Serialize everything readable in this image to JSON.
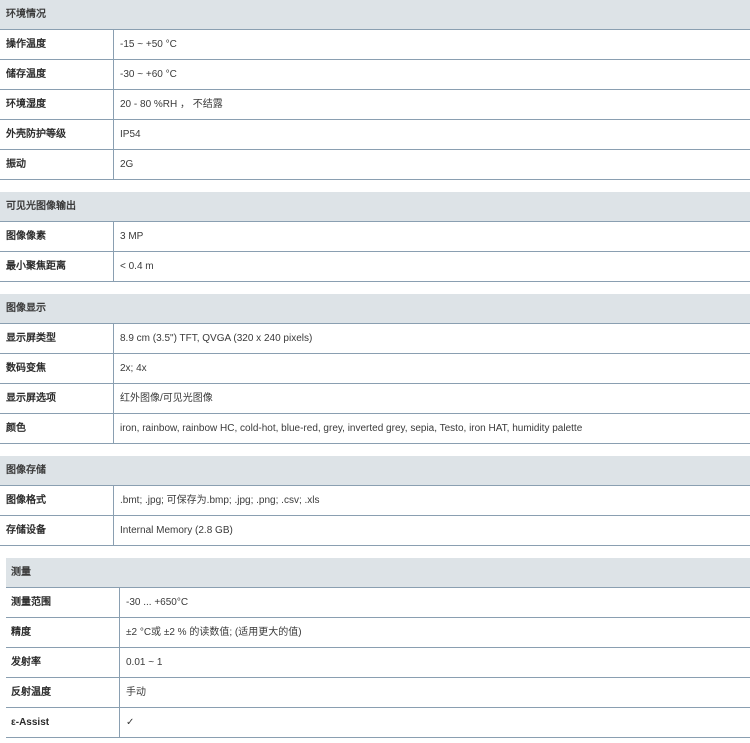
{
  "sections": [
    {
      "title": "环境情况",
      "rows": [
        {
          "label": "操作温度",
          "value": "-15 ~ +50 °C"
        },
        {
          "label": "储存温度",
          "value": "-30 ~ +60 °C"
        },
        {
          "label": "环境湿度",
          "value": "20 - 80 %RH ， 不结露"
        },
        {
          "label": "外壳防护等级",
          "value": "IP54"
        },
        {
          "label": "振动",
          "value": "2G"
        }
      ]
    },
    {
      "title": "可见光图像输出",
      "rows": [
        {
          "label": "图像像素",
          "value": "3 MP"
        },
        {
          "label": "最小聚焦距离",
          "value": "< 0.4 m"
        }
      ]
    },
    {
      "title": "图像显示",
      "rows": [
        {
          "label": "显示屏类型",
          "value": "8.9 cm (3.5\") TFT, QVGA (320 x 240 pixels)"
        },
        {
          "label": "数码变焦",
          "value": "2x; 4x"
        },
        {
          "label": "显示屏选项",
          "value": "红外图像/可见光图像"
        },
        {
          "label": "颜色",
          "value": "iron, rainbow, rainbow HC, cold-hot, blue-red, grey, inverted grey, sepia, Testo, iron HAT, humidity palette"
        }
      ]
    },
    {
      "title": "图像存储",
      "rows": [
        {
          "label": "图像格式",
          "value": ".bmt; .jpg; 可保存为.bmp; .jpg; .png; .csv; .xls"
        },
        {
          "label": "存储设备",
          "value": "Internal Memory (2.8 GB)"
        }
      ]
    },
    {
      "title": "测量",
      "rows": [
        {
          "label": "测量范围",
          "value": "-30 ... +650°C"
        },
        {
          "label": "精度",
          "value": "±2 °C或 ±2 % 的读数值; (适用更大的值)"
        },
        {
          "label": "发射率",
          "value": "0.01 ~ 1"
        },
        {
          "label": "反射温度",
          "value": "手动"
        },
        {
          "label": "ε-Assist",
          "value": "✓"
        }
      ]
    }
  ]
}
